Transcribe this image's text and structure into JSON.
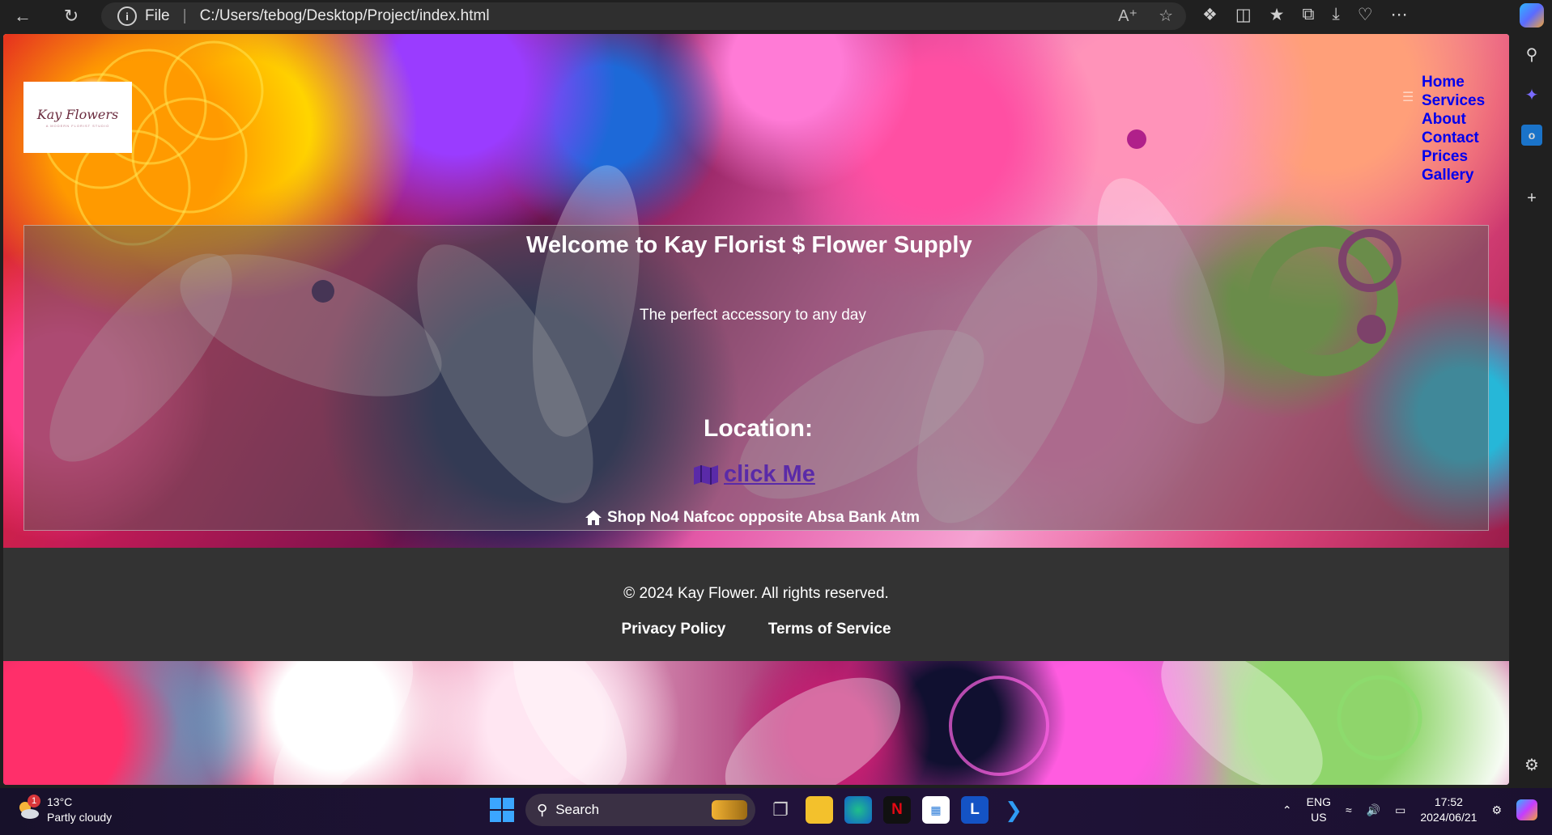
{
  "browser": {
    "address_file_label": "File",
    "address_url": "C:/Users/tebog/Desktop/Project/index.html"
  },
  "page": {
    "nav": {
      "links": [
        "Home",
        "Services",
        "About",
        "Contact",
        "Prices",
        "Gallery"
      ]
    },
    "logo": {
      "name": "Kay Flowers",
      "tagline": "A MODERN FLORIST STUDIO"
    },
    "hero": {
      "title": "Welcome to Kay Florist $ Flower Supply",
      "tagline": "The perfect accessory to any day",
      "location_heading": "Location:",
      "click_link": "click Me",
      "address": "Shop No4 Nafcoc opposite Absa Bank Atm"
    },
    "footer": {
      "copyright": "© 2024 Kay Flower. All rights reserved.",
      "privacy": "Privacy Policy",
      "terms": "Terms of Service"
    }
  },
  "taskbar": {
    "weather_temp": "13°C",
    "weather_desc": "Partly cloudy",
    "weather_badge": "1",
    "search_label": "Search",
    "lang_top": "ENG",
    "lang_bottom": "US",
    "time": "17:52",
    "date": "2024/06/21",
    "app_letter_l": "L"
  },
  "colors": {
    "nav_link": "#0000ee",
    "visited_link": "#5a2aa8",
    "footer_bg": "#333333"
  }
}
